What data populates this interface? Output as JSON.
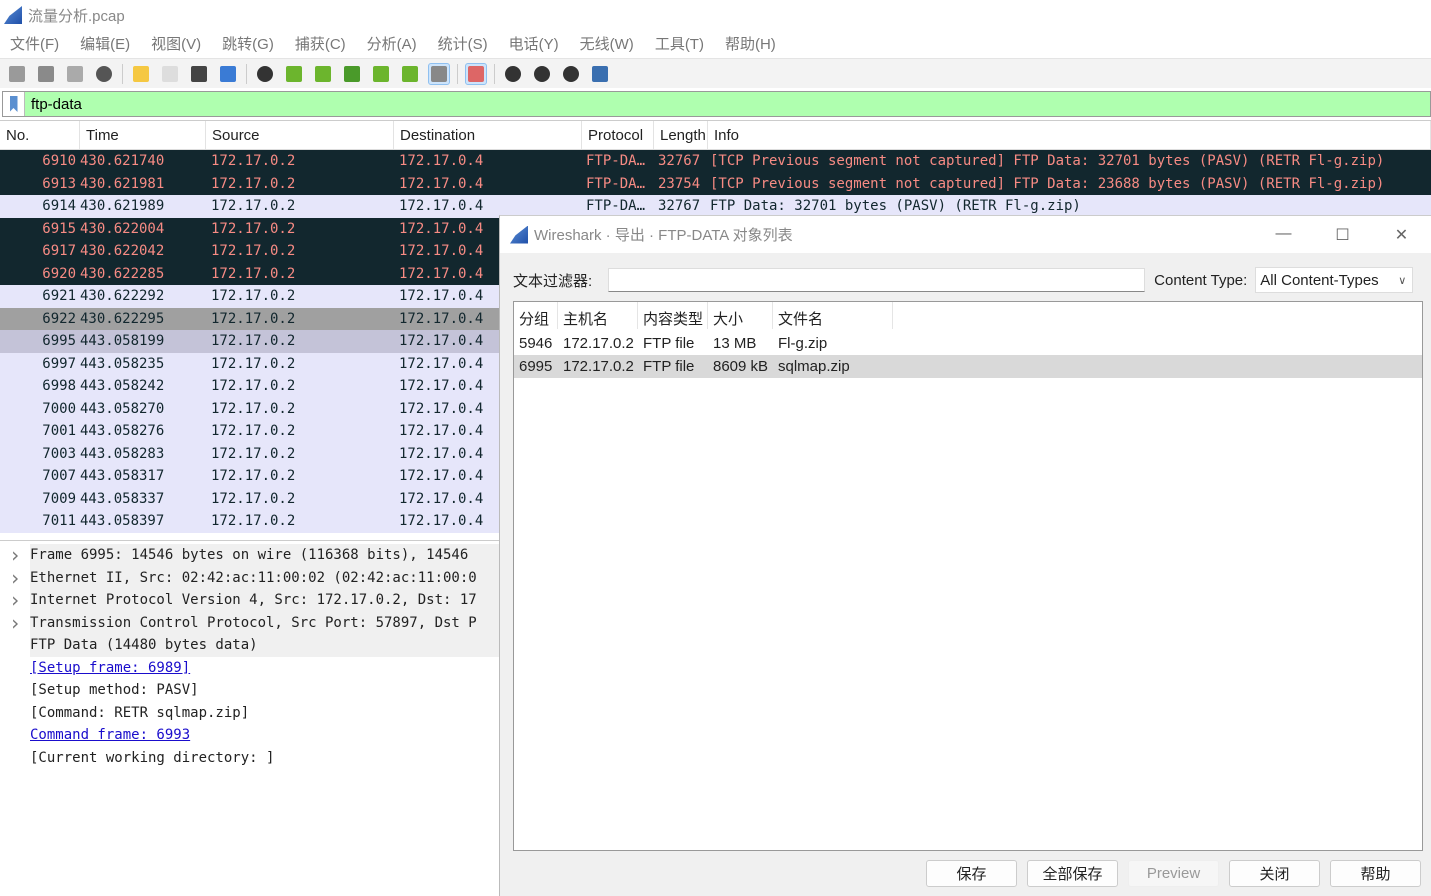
{
  "app": {
    "title": "流量分析.pcap"
  },
  "menu": [
    "文件(F)",
    "编辑(E)",
    "视图(V)",
    "跳转(G)",
    "捕获(C)",
    "分析(A)",
    "统计(S)",
    "电话(Y)",
    "无线(W)",
    "工具(T)",
    "帮助(H)"
  ],
  "toolbar": [
    {
      "icon": "start-capture-icon",
      "color": "#9a9a9a"
    },
    {
      "icon": "stop-capture-icon",
      "color": "#8a8a8a"
    },
    {
      "icon": "restart-capture-icon",
      "color": "#aaaaaa"
    },
    {
      "icon": "capture-options-icon",
      "color": "#555555"
    },
    "sep",
    {
      "icon": "open-file-icon",
      "color": "#f5c842"
    },
    {
      "icon": "save-file-icon",
      "color": "#dddddd"
    },
    {
      "icon": "close-file-icon",
      "color": "#444444"
    },
    {
      "icon": "reload-file-icon",
      "color": "#3a7bd5"
    },
    "sep",
    {
      "icon": "find-packet-icon",
      "color": "#333333"
    },
    {
      "icon": "go-back-icon",
      "color": "#6cb52d"
    },
    {
      "icon": "go-forward-icon",
      "color": "#6cb52d"
    },
    {
      "icon": "go-to-packet-icon",
      "color": "#4a9a2a"
    },
    {
      "icon": "first-packet-icon",
      "color": "#6cb52d"
    },
    {
      "icon": "last-packet-icon",
      "color": "#6cb52d"
    },
    {
      "icon": "auto-scroll-icon",
      "color": "#888888",
      "active": true
    },
    "sep",
    {
      "icon": "colorize-icon",
      "color": "#d66",
      "active": true
    },
    "sep",
    {
      "icon": "zoom-in-icon",
      "color": "#333333"
    },
    {
      "icon": "zoom-out-icon",
      "color": "#333333"
    },
    {
      "icon": "zoom-reset-icon",
      "color": "#333333"
    },
    {
      "icon": "resize-columns-icon",
      "color": "#3a6fb0"
    }
  ],
  "filter": {
    "value": "ftp-data",
    "bg": "#afffaf"
  },
  "packet_list": {
    "columns": [
      "No.",
      "Time",
      "Source",
      "Destination",
      "Protocol",
      "Length",
      "Info"
    ],
    "rows": [
      {
        "no": "6910",
        "time": "430.621740",
        "src": "172.17.0.2",
        "dst": "172.17.0.4",
        "proto": "FTP-DA…",
        "len": "32767",
        "info": "[TCP Previous segment not captured] FTP Data: 32701 bytes (PASV) (RETR Fl-g.zip)",
        "style": "dark"
      },
      {
        "no": "6913",
        "time": "430.621981",
        "src": "172.17.0.2",
        "dst": "172.17.0.4",
        "proto": "FTP-DA…",
        "len": "23754",
        "info": "[TCP Previous segment not captured] FTP Data: 23688 bytes (PASV) (RETR Fl-g.zip)",
        "style": "dark"
      },
      {
        "no": "6914",
        "time": "430.621989",
        "src": "172.17.0.2",
        "dst": "172.17.0.4",
        "proto": "FTP-DA…",
        "len": "32767",
        "info": "FTP Data: 32701 bytes (PASV) (RETR Fl-g.zip)",
        "style": "light"
      },
      {
        "no": "6915",
        "time": "430.622004",
        "src": "172.17.0.2",
        "dst": "172.17.0.4",
        "style": "dark"
      },
      {
        "no": "6917",
        "time": "430.622042",
        "src": "172.17.0.2",
        "dst": "172.17.0.4",
        "style": "dark"
      },
      {
        "no": "6920",
        "time": "430.622285",
        "src": "172.17.0.2",
        "dst": "172.17.0.4",
        "style": "dark"
      },
      {
        "no": "6921",
        "time": "430.622292",
        "src": "172.17.0.2",
        "dst": "172.17.0.4",
        "style": "light"
      },
      {
        "no": "6922",
        "time": "430.622295",
        "src": "172.17.0.2",
        "dst": "172.17.0.4",
        "style": "gray"
      },
      {
        "no": "6995",
        "time": "443.058199",
        "src": "172.17.0.2",
        "dst": "172.17.0.4",
        "style": "sel"
      },
      {
        "no": "6997",
        "time": "443.058235",
        "src": "172.17.0.2",
        "dst": "172.17.0.4",
        "style": "light"
      },
      {
        "no": "6998",
        "time": "443.058242",
        "src": "172.17.0.2",
        "dst": "172.17.0.4",
        "style": "light"
      },
      {
        "no": "7000",
        "time": "443.058270",
        "src": "172.17.0.2",
        "dst": "172.17.0.4",
        "style": "light"
      },
      {
        "no": "7001",
        "time": "443.058276",
        "src": "172.17.0.2",
        "dst": "172.17.0.4",
        "style": "light"
      },
      {
        "no": "7003",
        "time": "443.058283",
        "src": "172.17.0.2",
        "dst": "172.17.0.4",
        "style": "light"
      },
      {
        "no": "7007",
        "time": "443.058317",
        "src": "172.17.0.2",
        "dst": "172.17.0.4",
        "style": "light"
      },
      {
        "no": "7009",
        "time": "443.058337",
        "src": "172.17.0.2",
        "dst": "172.17.0.4",
        "style": "light"
      },
      {
        "no": "7011",
        "time": "443.058397",
        "src": "172.17.0.2",
        "dst": "172.17.0.4",
        "style": "light"
      }
    ]
  },
  "details": [
    {
      "text": "Frame 6995: 14546 bytes on wire (116368 bits), 14546",
      "expand": true
    },
    {
      "text": "Ethernet II, Src: 02:42:ac:11:00:02 (02:42:ac:11:00:0",
      "expand": true
    },
    {
      "text": "Internet Protocol Version 4, Src: 172.17.0.2, Dst: 17",
      "expand": true
    },
    {
      "text": "Transmission Control Protocol, Src Port: 57897, Dst P",
      "expand": true
    },
    {
      "text": "FTP Data (14480 bytes data)",
      "grey": true
    },
    {
      "text": "[Setup frame: 6989]",
      "link": true
    },
    {
      "text": "[Setup method: PASV]"
    },
    {
      "text": "[Command: RETR sqlmap.zip]"
    },
    {
      "text": "Command frame: 6993",
      "link": true
    },
    {
      "text": "[Current working directory: ]"
    }
  ],
  "dialog": {
    "title": "Wireshark · 导出 · FTP-DATA 对象列表",
    "filter_label": "文本过滤器:",
    "filter_value": "",
    "content_type_label": "Content Type:",
    "content_type_value": "All Content-Types",
    "columns": [
      "分组",
      "主机名",
      "内容类型",
      "大小",
      "文件名"
    ],
    "rows": [
      [
        "5946",
        "172.17.0.2",
        "FTP file",
        "13 MB",
        "Fl-g.zip"
      ],
      [
        "6995",
        "172.17.0.2",
        "FTP file",
        "8609 kB",
        "sqlmap.zip"
      ]
    ],
    "selected_row": 1,
    "buttons": {
      "save": "保存",
      "save_all": "全部保存",
      "preview": "Preview",
      "close": "关闭",
      "help": "帮助"
    }
  }
}
